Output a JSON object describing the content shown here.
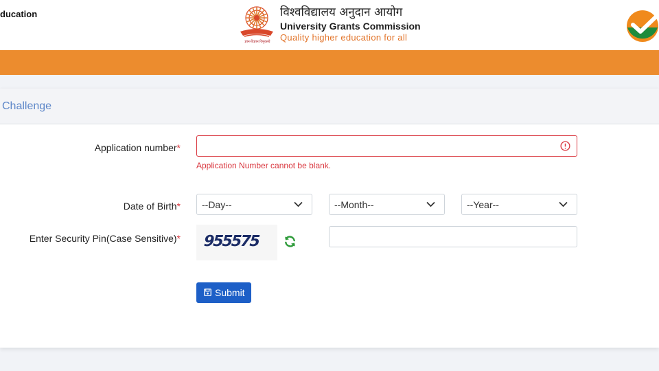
{
  "header": {
    "left_brand": "ducation",
    "hindi_name": "विश्वविद्यालय अनुदान आयोग",
    "english_name": "University Grants Commission",
    "tagline": "Quality higher education for all",
    "emblem_caption": "ज्ञान-विज्ञान विमुक्तये"
  },
  "form": {
    "title": "Challenge",
    "application_number": {
      "label": "Application number",
      "required_mark": "*",
      "value": "",
      "error": "Application Number cannot be blank."
    },
    "dob": {
      "label": "Date of Birth",
      "required_mark": "*",
      "day": "--Day--",
      "month": "--Month--",
      "year": "--Year--"
    },
    "security_pin": {
      "label": "Enter Security Pin(Case Sensitive)",
      "required_mark": "*",
      "captcha": "955575",
      "value": ""
    },
    "submit_label": "Submit"
  },
  "colors": {
    "orange_band": "#ec8c2e",
    "title_blue": "#5c86c8",
    "error_red": "#d9363e",
    "submit_blue": "#1d5fc7",
    "refresh_green": "#2e9b3a",
    "tagline_orange": "#e2742a"
  },
  "icons": [
    "ugc-emblem-icon",
    "checkmark-logo-icon",
    "error-icon",
    "chevron-down-icon",
    "refresh-icon",
    "save-icon"
  ]
}
